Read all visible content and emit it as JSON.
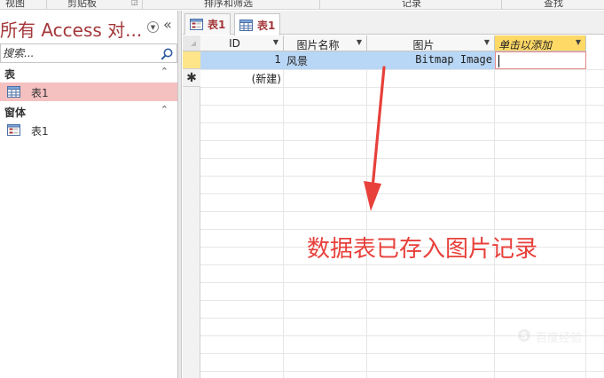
{
  "ribbon": {
    "groups": [
      "视图",
      "剪贴板",
      "排序和筛选",
      "记录",
      "查找"
    ]
  },
  "nav": {
    "title": "所有 Access 对...",
    "search_placeholder": "搜索...",
    "groups": [
      {
        "label": "表",
        "items": [
          {
            "label": "表1",
            "selected": true,
            "icon": "table-icon"
          }
        ]
      },
      {
        "label": "窗体",
        "items": [
          {
            "label": "表1",
            "selected": false,
            "icon": "form-icon"
          }
        ]
      }
    ],
    "chevron": "«",
    "group_chevron": "⌃"
  },
  "tabs": [
    {
      "label": "表1",
      "icon": "form-icon",
      "active": false
    },
    {
      "label": "表1",
      "icon": "table-icon",
      "active": true
    }
  ],
  "grid": {
    "columns": [
      {
        "label": "ID",
        "dropdown": "▼"
      },
      {
        "label": "图片名称",
        "dropdown": "▼"
      },
      {
        "label": "图片",
        "dropdown": "▼"
      },
      {
        "label": "单击以添加",
        "dropdown": "▼"
      }
    ],
    "rows": [
      {
        "id": "1",
        "name": "风景",
        "image": "Bitmap Image",
        "extra": ""
      }
    ],
    "new_row": {
      "marker": "✱",
      "id": "(新建)"
    }
  },
  "annotation": {
    "text": "数据表已存入图片记录",
    "color": "#e8403b"
  },
  "watermark": {
    "logo": "S",
    "text": "百度经验"
  },
  "colors": {
    "accent": "#a4373a",
    "selected_nav": "#f5c0c0",
    "selected_row": "#b8d6f5",
    "add_column": "#ffd966"
  }
}
